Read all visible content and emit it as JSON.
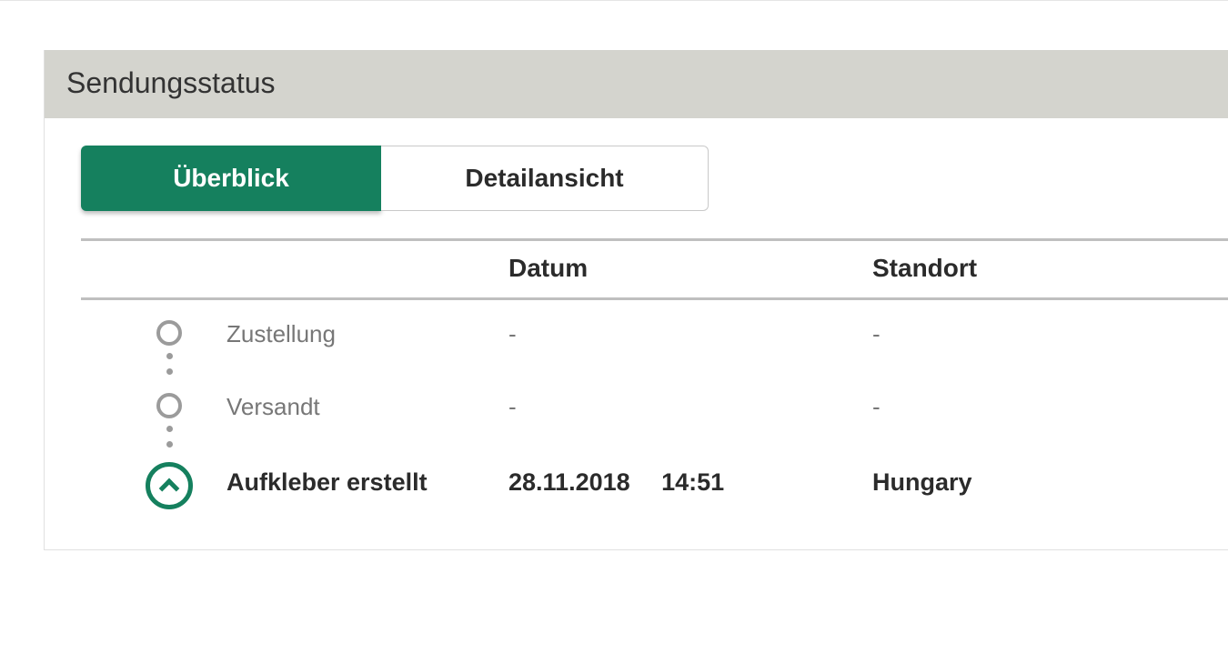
{
  "colors": {
    "accent": "#15805e"
  },
  "panel": {
    "title": "Sendungsstatus"
  },
  "tabs": {
    "overview": "Überblick",
    "detail": "Detailansicht",
    "active": "overview"
  },
  "table": {
    "headers": {
      "date": "Datum",
      "location": "Standort"
    },
    "rows": [
      {
        "status": "Zustellung",
        "date": "-",
        "location": "-",
        "state": "future",
        "bold": false
      },
      {
        "status": "Versandt",
        "date": "-",
        "location": "-",
        "state": "future",
        "bold": false
      },
      {
        "status": "Aufkleber erstellt",
        "date": "28.11.2018  14:51",
        "location": "Hungary",
        "state": "current",
        "bold": true
      }
    ]
  }
}
